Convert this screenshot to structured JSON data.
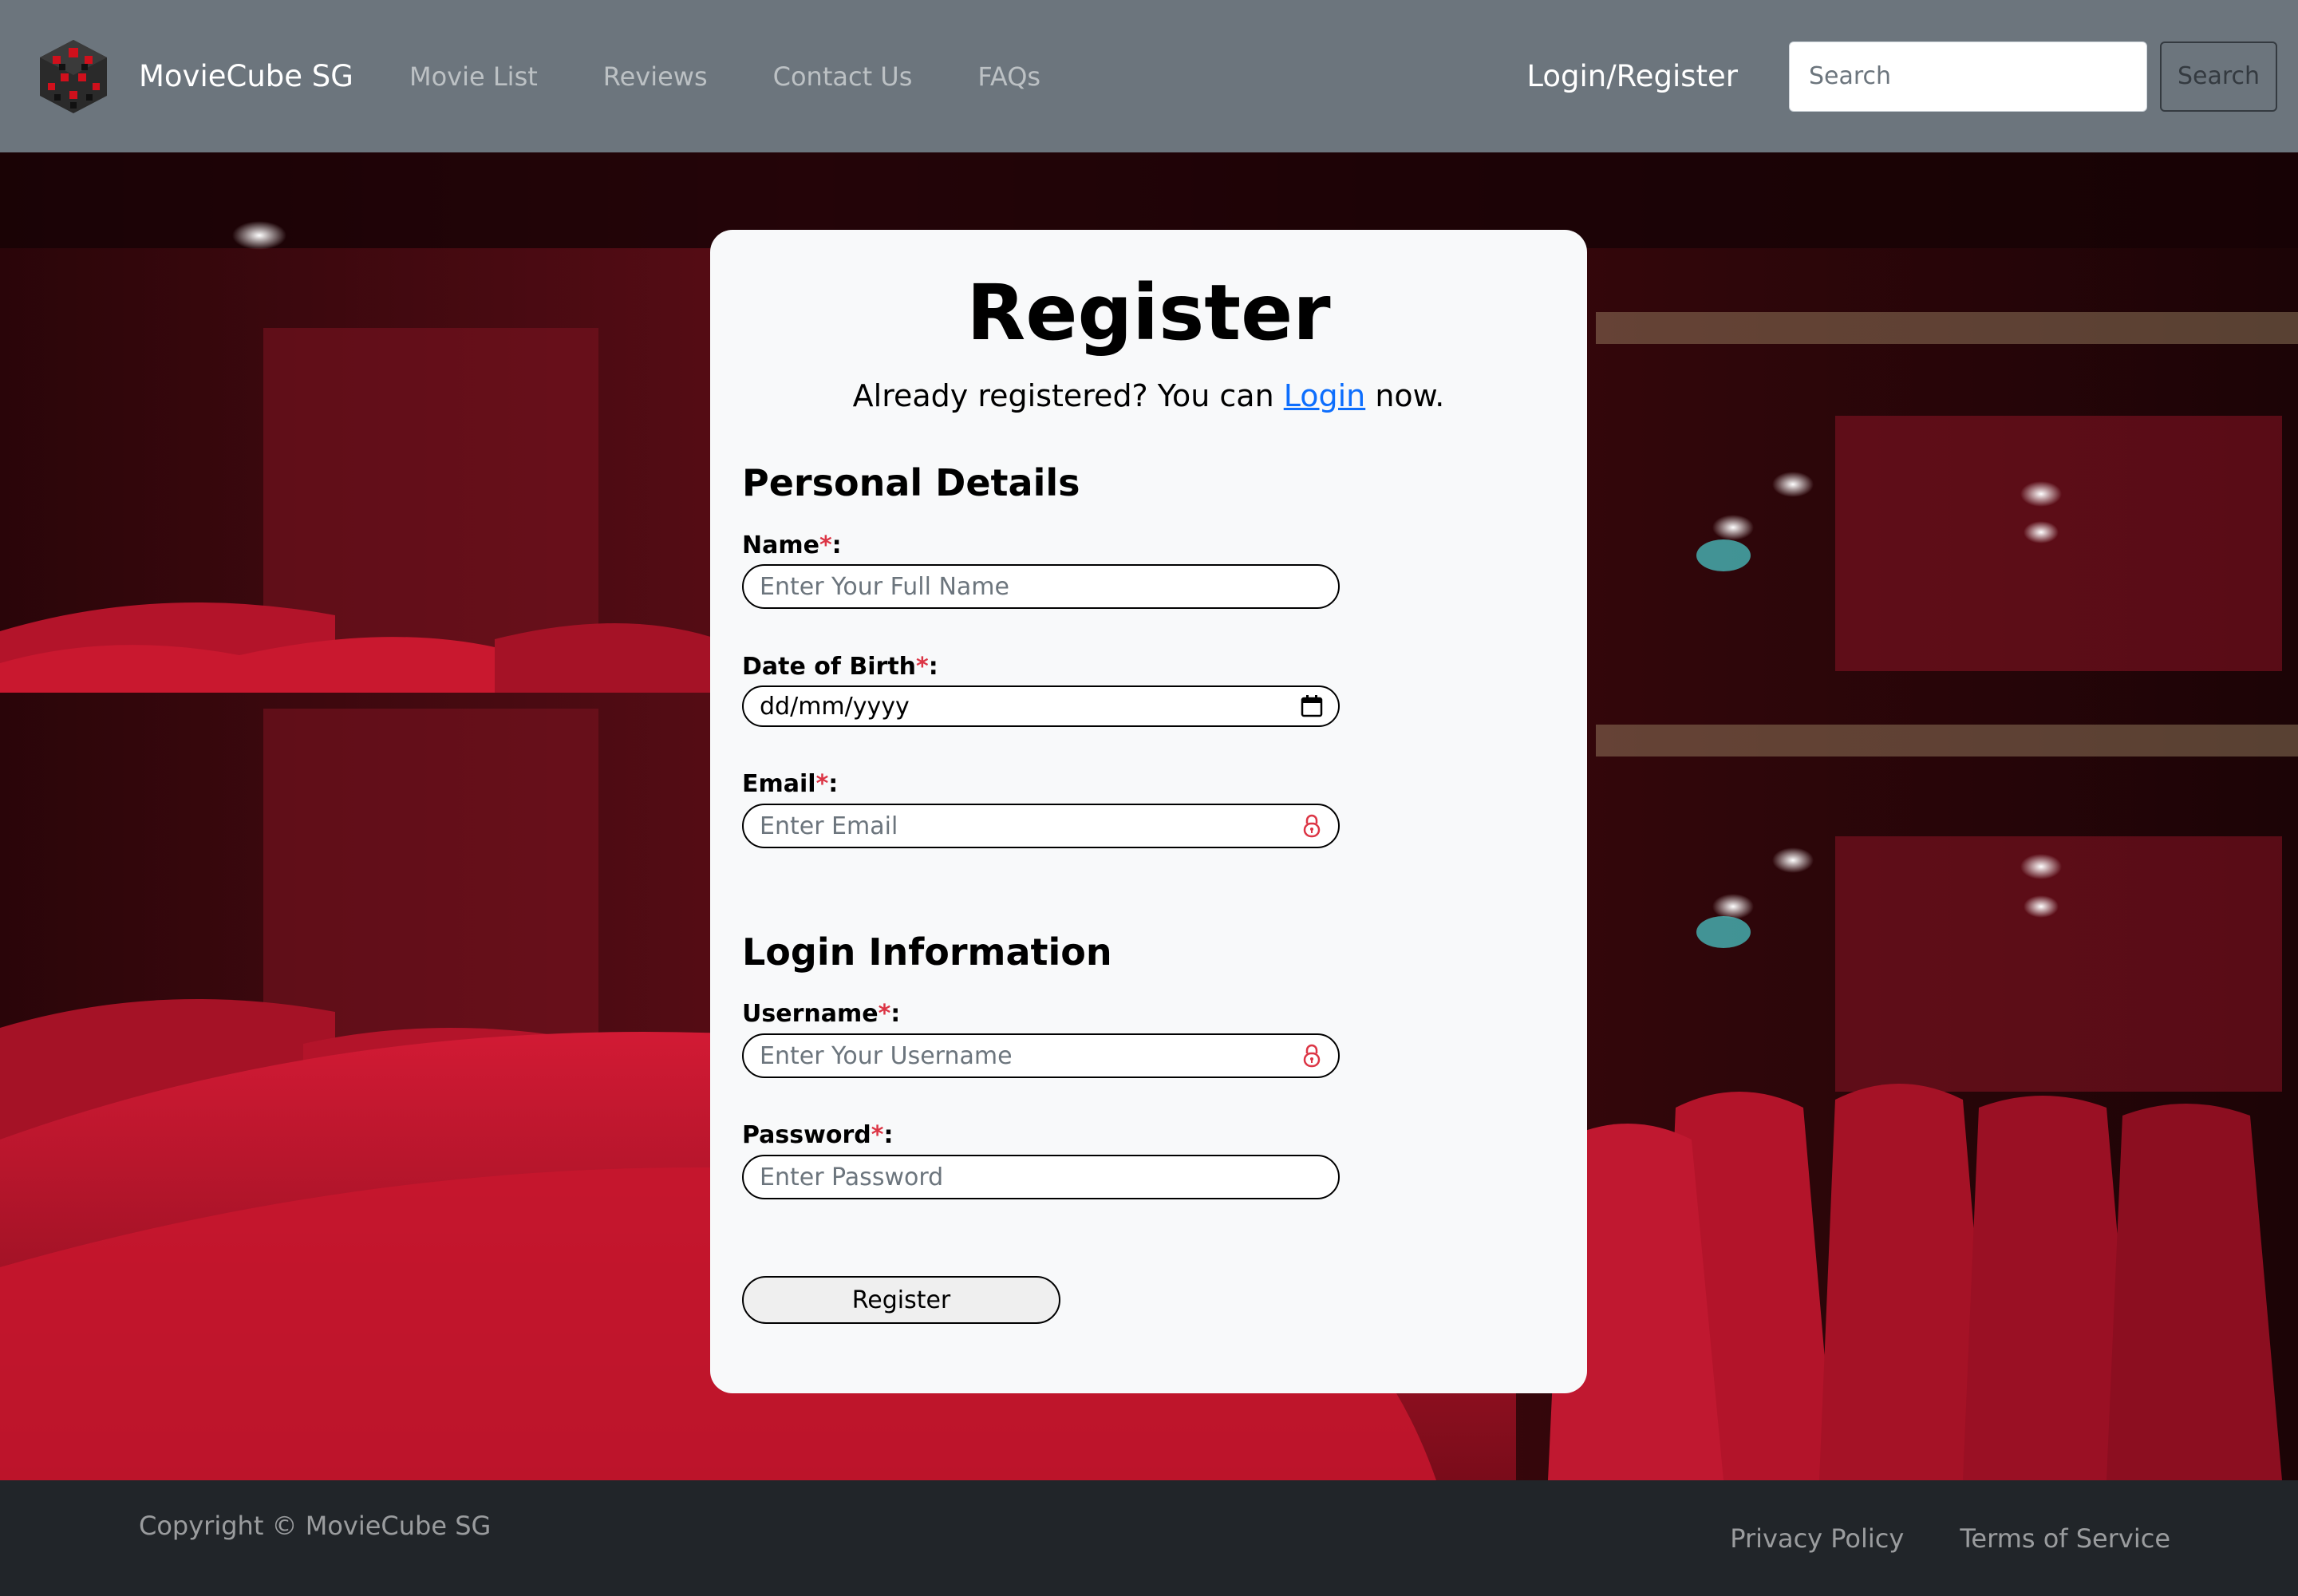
{
  "navbar": {
    "logo_icon": "cube-logo-icon",
    "brand": "MovieCube SG",
    "links": [
      "Movie List",
      "Reviews",
      "Contact Us",
      "FAQs"
    ],
    "login_register": "Login/Register",
    "search_placeholder": "Search",
    "search_button": "Search"
  },
  "form": {
    "title": "Register",
    "subtitle_before": "Already registered? You can ",
    "subtitle_link": "Login",
    "subtitle_after": " now.",
    "required_marker": "*",
    "personal_heading": "Personal Details",
    "name_label": "Name",
    "name_placeholder": "Enter Your Full Name",
    "dob_label": "Date of Birth",
    "dob_value": "dd/mm/yyyy",
    "dob_icon": "calendar-icon",
    "email_label": "Email",
    "email_placeholder": "Enter Email",
    "email_icon": "lock-icon",
    "login_heading": "Login Information",
    "username_label": "Username",
    "username_placeholder": "Enter Your Username",
    "username_icon": "lock-icon",
    "password_label": "Password",
    "password_placeholder": "Enter Password",
    "submit": "Register",
    "label_suffix": ":"
  },
  "footer": {
    "copyright": "Copyright © MovieCube SG",
    "links": [
      "Privacy Policy",
      "Terms of Service"
    ]
  },
  "colors": {
    "navbar": "#6c757d",
    "footer": "#212529",
    "card": "#f8f9fa",
    "required": "#dc3545",
    "link": "#0d6efd",
    "seat_red": "#b8102a"
  }
}
